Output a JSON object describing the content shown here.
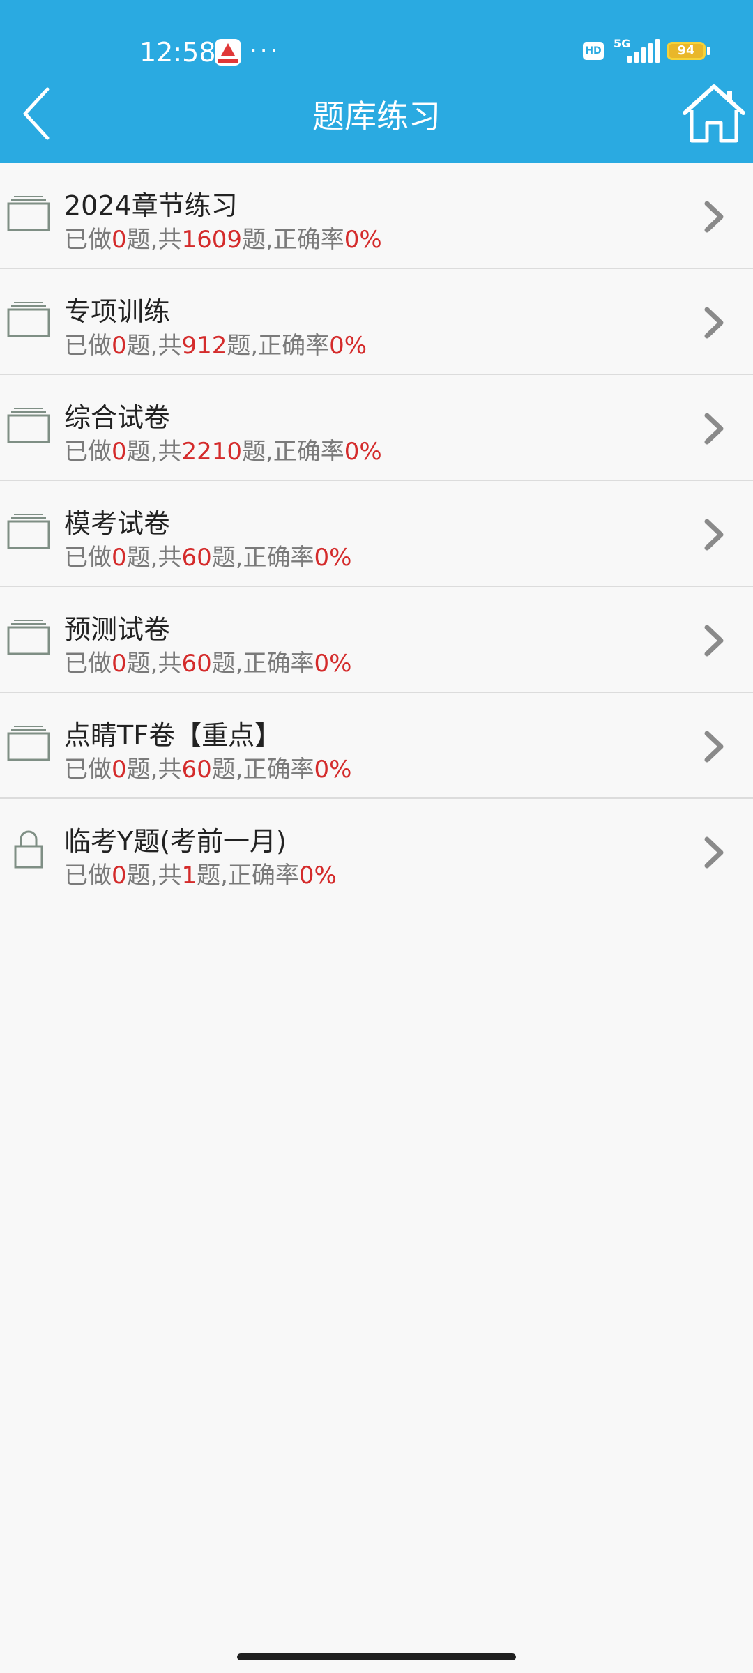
{
  "status_bar": {
    "time": "12:58",
    "app_icon": "app-notification-icon",
    "dots": "···",
    "hd_label": "HD",
    "network_label": "5G",
    "battery_level": "94"
  },
  "nav": {
    "title": "题库练习",
    "back_icon": "chevron-left-icon",
    "home_icon": "home-icon"
  },
  "colors": {
    "header": "#2aaae1",
    "highlight": "#d42b2b",
    "background": "#f8f8f8"
  },
  "list": {
    "done_prefix": "已做",
    "mid_text": "题,共",
    "rate_text": "题,正确率",
    "items": [
      {
        "icon": "folder-icon",
        "title": "2024章节练习",
        "done": "0",
        "total": "1609",
        "rate": "0%"
      },
      {
        "icon": "folder-icon",
        "title": "专项训练",
        "done": "0",
        "total": "912",
        "rate": "0%"
      },
      {
        "icon": "folder-icon",
        "title": "综合试卷",
        "done": "0",
        "total": "2210",
        "rate": "0%"
      },
      {
        "icon": "folder-icon",
        "title": "模考试卷",
        "done": "0",
        "total": "60",
        "rate": "0%"
      },
      {
        "icon": "folder-icon",
        "title": "预测试卷",
        "done": "0",
        "total": "60",
        "rate": "0%"
      },
      {
        "icon": "folder-icon",
        "title": "点睛TF卷【重点】",
        "done": "0",
        "total": "60",
        "rate": "0%"
      },
      {
        "icon": "lock-icon",
        "title": "临考Y题(考前一月)",
        "done": "0",
        "total": "1",
        "rate": "0%"
      }
    ]
  }
}
